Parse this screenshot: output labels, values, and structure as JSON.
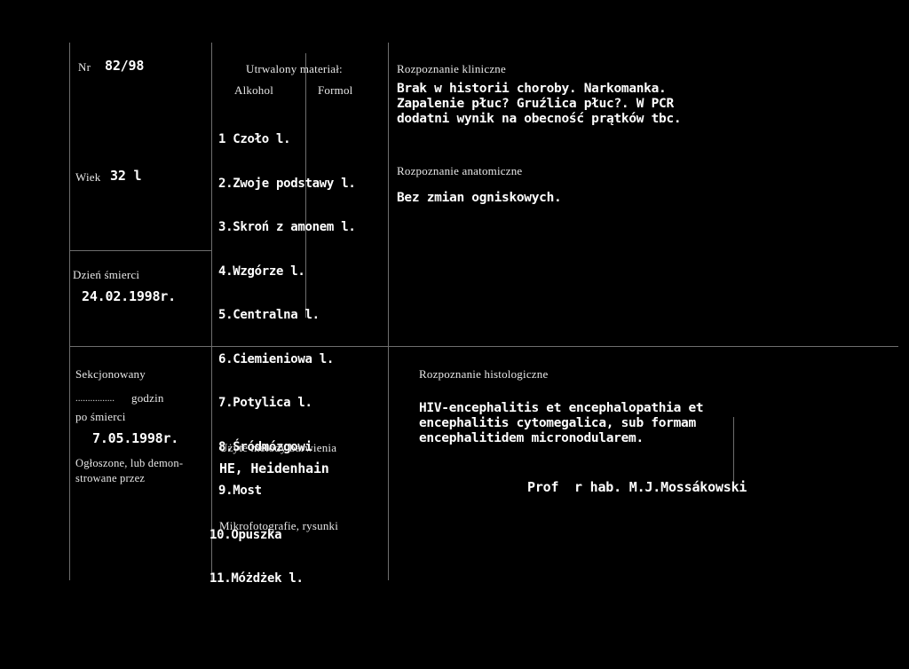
{
  "document": {
    "type": "autopsy-protocol-form",
    "language": "pl"
  },
  "fields": {
    "nr_label": "Nr",
    "nr_value": "82/98",
    "wiek_label": "Wiek",
    "wiek_value": "32 l",
    "dzien_smierci_label": "Dzień śmierci",
    "dzien_smierci_value": "24.02.1998r.",
    "sekcjonowany_label": "Sekcjonowany",
    "godzin_dots": "................",
    "godzin_label": "godzin",
    "po_smierci_label": "po śmierci",
    "po_smierci_value": "7.05.1998r.",
    "ogloszone_label": "Ogłoszone, lub demon-",
    "ogloszone_label2": "strowane przez"
  },
  "material": {
    "heading": "Utrwalony materiał:",
    "col_alkohol": "Alkohol",
    "col_formol": "Formol",
    "items": [
      "1 Czoło l.",
      "2.Zwoje podstawy l.",
      "3.Skroń z amonem l.",
      "4.Wzgórze l.",
      "5.Centralna l.",
      "6.Ciemieniowa l.",
      "7.Potylica l.",
      "8.Śródmózgowi",
      "9.Most",
      "10.Opuszka",
      "11.Móżdżek l."
    ]
  },
  "methods": {
    "heading": "Użyte metody barwienia",
    "value": "HE, Heidenhain",
    "microphoto_label": "Mikrofotografie, rysunki"
  },
  "diagnoses": {
    "clinical_heading": "Rozpoznanie kliniczne",
    "clinical_text": "Brak w historii choroby. Narkomanka.\nZapalenie płuc? Gruźlica płuc?. W PCR\ndodatni wynik na obecność prątków tbc.",
    "anatomic_heading": "Rozpoznanie anatomiczne",
    "anatomic_text": "Bez zmian ogniskowych.",
    "histologic_heading": "Rozpoznanie histologiczne",
    "histologic_text": "HIV-encephalitis et encephalopathia et\nencephalitis cytomegalica, sub formam\nencephalitidem micronodularem.",
    "signature": "Prof  r hab. M.J.Mossákowski"
  },
  "colors": {
    "background": "#000000",
    "text": "#ffffff",
    "rule": "#6e6e6e"
  }
}
